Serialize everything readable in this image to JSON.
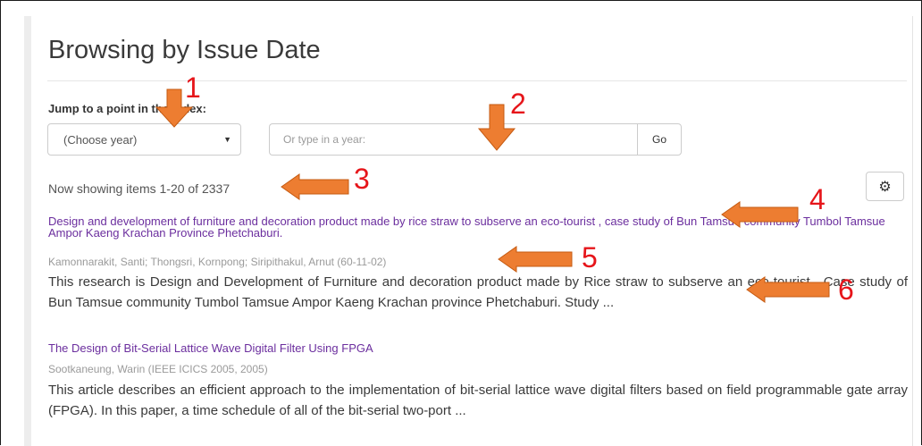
{
  "page": {
    "title": "Browsing by Issue Date"
  },
  "jump": {
    "label": "Jump to a point in the index:",
    "year_select_value": "(Choose year)",
    "year_input_placeholder": "Or type in a year:",
    "go_label": "Go"
  },
  "results": {
    "showing_text": "Now showing items 1-20 of 2337",
    "settings_icon": "gear-icon"
  },
  "items": [
    {
      "title": "Design and development of furniture and decoration product made by rice straw to subserve an eco-tourist , case study of Bun Tamsue community Tumbol Tamsue Ampor Kaeng Krachan Province Phetchaburi.",
      "meta": "Kamonnarakit, Santi; Thongsri, Kornpong; Siripithakul, Arnut (60-11-02)",
      "abstract": "This research is Design and Development of Furniture and decoration product made by Rice straw to subserve an eco-tourist , Case study of Bun Tamsue community Tumbol Tamsue Ampor Kaeng Krachan province Phetchaburi. Study ..."
    },
    {
      "title": "The Design of Bit-Serial Lattice Wave Digital Filter Using FPGA",
      "meta": "Sootkaneung, Warin (IEEE ICICS 2005, 2005)",
      "abstract": "This article describes an efficient approach to the implementation of bit-serial lattice wave digital filters based on field programmable gate array (FPGA). In this paper, a time schedule of all of the bit-serial two-port ..."
    }
  ],
  "annotations": [
    "1",
    "2",
    "3",
    "4",
    "5",
    "6"
  ],
  "colors": {
    "link": "#6b2e9e",
    "arrow": "#ed7d31",
    "annotation": "#e6151a"
  }
}
